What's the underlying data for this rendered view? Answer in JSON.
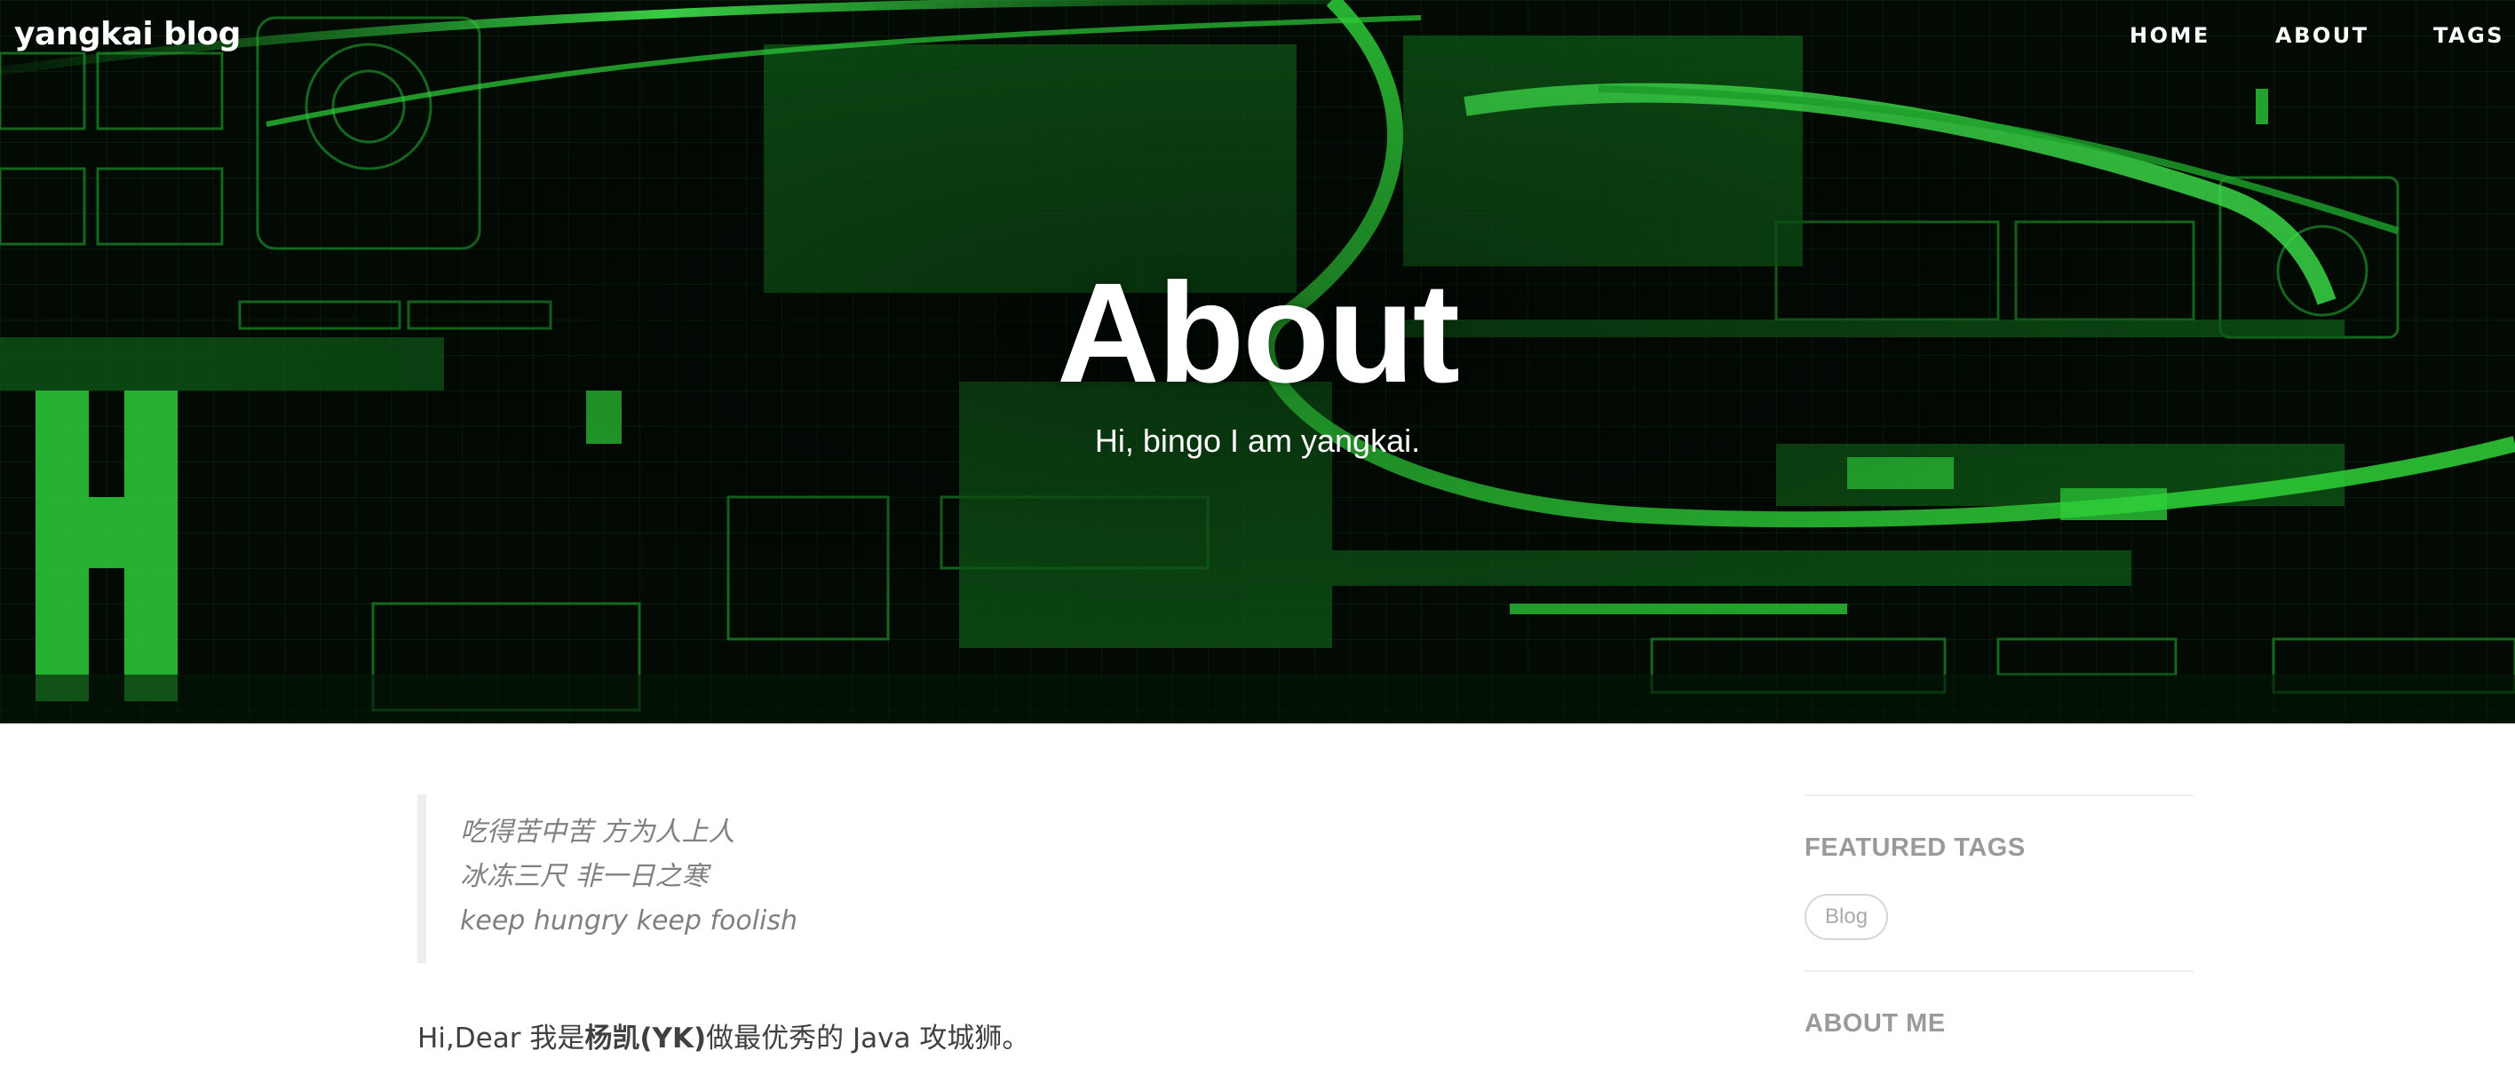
{
  "site": {
    "brand": "yangkai blog"
  },
  "nav": {
    "items": [
      {
        "label": "HOME"
      },
      {
        "label": "ABOUT"
      },
      {
        "label": "TAGS"
      }
    ]
  },
  "hero": {
    "title": "About",
    "subtitle": "Hi, bingo I am yangkai."
  },
  "post": {
    "quote_lines": [
      "吃得苦中苦 方为人上人",
      "冰冻三尺 非一日之寒",
      "keep hungry keep foolish"
    ],
    "intro_prefix": "Hi,Dear 我是",
    "intro_bold": "杨凯(YK)",
    "intro_suffix": "做最优秀的 Java 攻城狮。"
  },
  "sidebar": {
    "featured_tags_heading": "FEATURED TAGS",
    "tags": [
      "Blog"
    ],
    "about_me_heading": "ABOUT ME"
  },
  "colors": {
    "hero_bg": "#020802",
    "hero_accent": "#2fd13a",
    "body_text": "#404040",
    "muted_text": "#808080",
    "sidebar_heading": "#9a9a9a",
    "rule": "#eeeeee"
  }
}
